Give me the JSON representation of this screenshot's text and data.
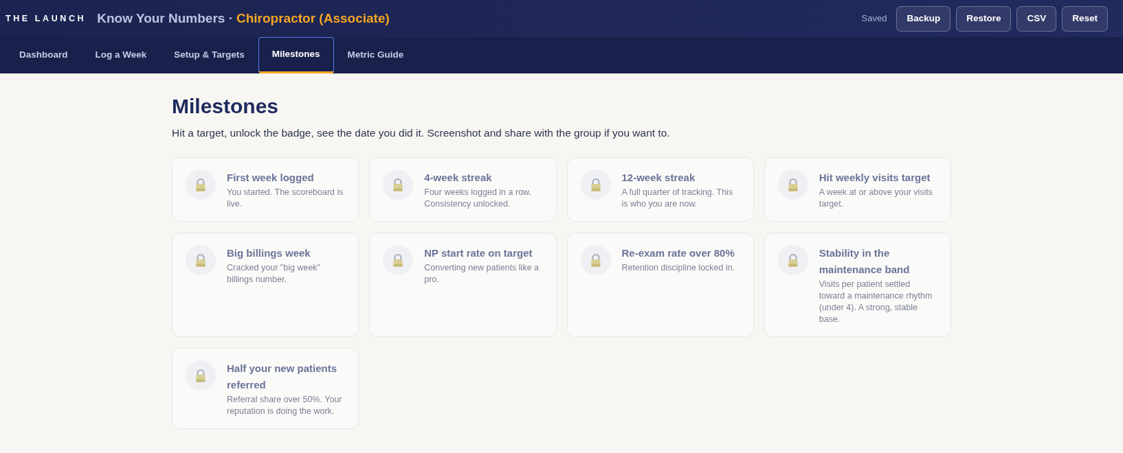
{
  "header": {
    "brand": "THE LAUNCH",
    "title": "Know Your Numbers ·",
    "role": "Chiropractor (Associate)",
    "save_status": "Saved",
    "buttons": [
      "Backup",
      "Restore",
      "CSV",
      "Reset"
    ]
  },
  "tabs": [
    {
      "label": "Dashboard",
      "selected": false
    },
    {
      "label": "Log a Week",
      "selected": false
    },
    {
      "label": "Setup & Targets",
      "selected": false
    },
    {
      "label": "Milestones",
      "selected": true
    },
    {
      "label": "Metric Guide",
      "selected": false
    }
  ],
  "page": {
    "heading": "Milestones",
    "intro": "Hit a target, unlock the badge, see the date you did it. Screenshot and share with the group if you want to."
  },
  "milestones": [
    {
      "title": "First week logged",
      "description": "You started. The scoreboard is live.",
      "locked": true
    },
    {
      "title": "4-week streak",
      "description": "Four weeks logged in a row. Consistency unlocked.",
      "locked": true
    },
    {
      "title": "12-week streak",
      "description": "A full quarter of tracking. This is who you are now.",
      "locked": true
    },
    {
      "title": "Hit weekly visits target",
      "description": "A week at or above your visits target.",
      "locked": true
    },
    {
      "title": "Big billings week",
      "description": "Cracked your \"big week\" billings number.",
      "locked": true
    },
    {
      "title": "NP start rate on target",
      "description": "Converting new patients like a pro.",
      "locked": true
    },
    {
      "title": "Re-exam rate over 80%",
      "description": "Retention discipline locked in.",
      "locked": true
    },
    {
      "title": "Stability in the maintenance band",
      "description": "Visits per patient settled toward a maintenance rhythm (under 4). A strong, stable base.",
      "locked": true
    },
    {
      "title": "Half your new patients referred",
      "description": "Referral share over 50%. Your reputation is doing the work.",
      "locked": true
    }
  ]
}
